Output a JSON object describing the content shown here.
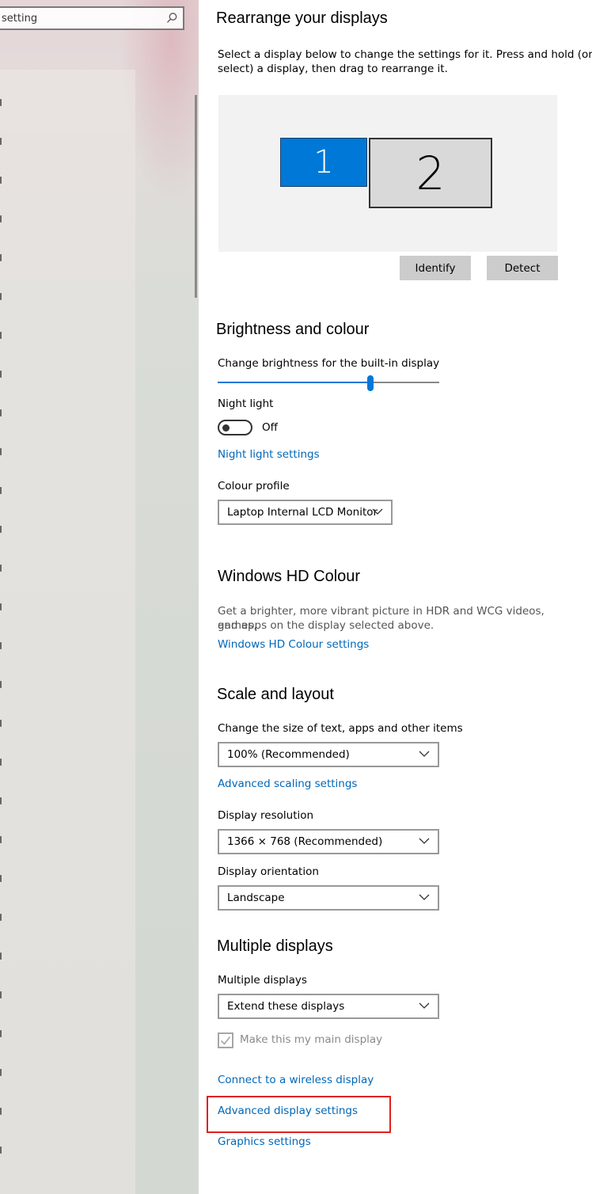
{
  "sidebar": {
    "search_value": "setting"
  },
  "arrange": {
    "title": "Rearrange your displays",
    "description_line1": "Select a display below to change the settings for it. Press and hold (or",
    "description_line2": "select) a display, then drag to rearrange it.",
    "display_1": "1",
    "display_2": "2",
    "identify_label": "Identify",
    "detect_label": "Detect",
    "selected_color": "#0078d7"
  },
  "brightness": {
    "title": "Brightness and colour",
    "slider_label": "Change brightness for the built-in display",
    "slider_value_percent": 69,
    "night_light_label": "Night light",
    "night_light_state": "Off",
    "night_light_settings_link": "Night light settings",
    "colour_profile_label": "Colour profile",
    "colour_profile_value": "Laptop Internal LCD Monitor"
  },
  "hdr": {
    "title": "Windows HD Colour",
    "description_line1": "Get a brighter, more vibrant picture in HDR and WCG videos, games,",
    "description_line2": "and apps on the display selected above.",
    "settings_link": "Windows HD Colour settings"
  },
  "scale": {
    "title": "Scale and layout",
    "size_label": "Change the size of text, apps and other items",
    "size_value": "100% (Recommended)",
    "advanced_scaling_link": "Advanced scaling settings",
    "resolution_label": "Display resolution",
    "resolution_value": "1366 × 768 (Recommended)",
    "orientation_label": "Display orientation",
    "orientation_value": "Landscape"
  },
  "multiple": {
    "title": "Multiple displays",
    "label": "Multiple displays",
    "value": "Extend these displays",
    "main_display_label": "Make this my main display",
    "main_display_checked": true,
    "wireless_link": "Connect to a wireless display",
    "advanced_display_link": "Advanced display settings",
    "graphics_link": "Graphics settings"
  },
  "colors": {
    "accent": "#0078d7",
    "link": "#0067b8",
    "highlight_box": "#e02020"
  }
}
